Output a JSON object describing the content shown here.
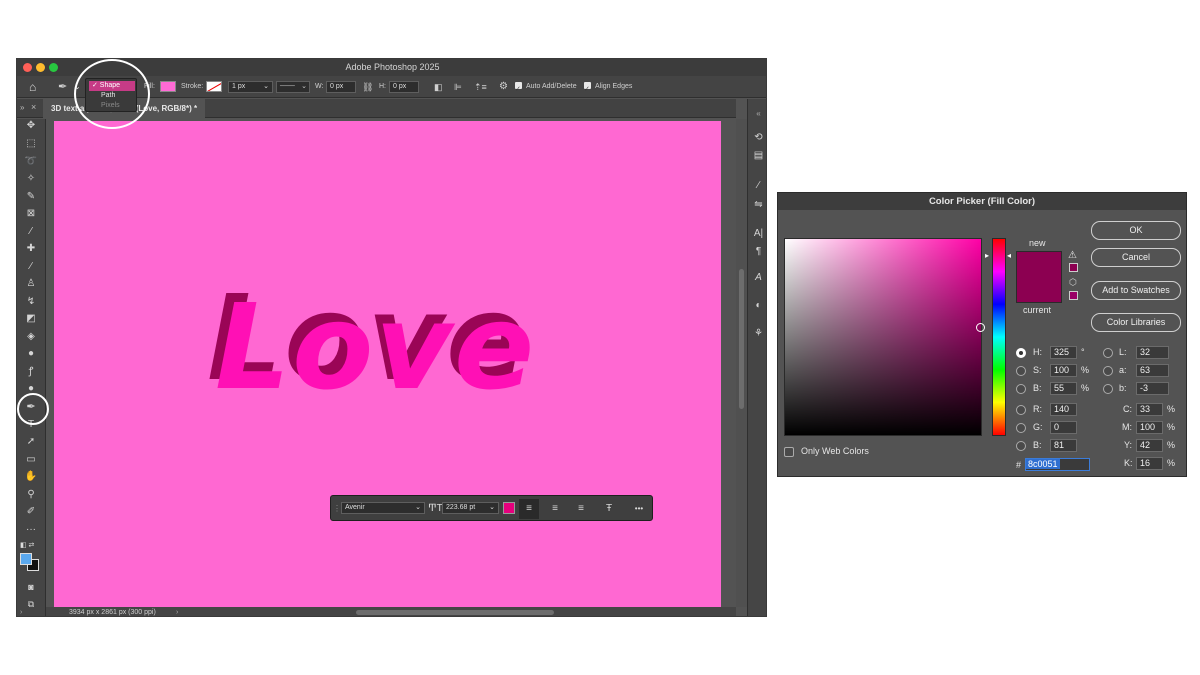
{
  "photoshop": {
    "title": "Adobe Photoshop 2025",
    "options": {
      "stroke_label": "Stroke:",
      "stroke_width": "1 px",
      "w_label": "W:",
      "w_value": "0 px",
      "h_label": "H:",
      "h_value": "0 px",
      "auto_add_delete": "Auto Add/Delete",
      "align_edges": "Align Edges",
      "fill_color": "#ff6ad5"
    },
    "mode_menu": {
      "shape": "✓ Shape",
      "path": "Path",
      "pixels": "Pixels"
    },
    "document_tab": "3D text a    psdc @ 50% (Love, RGB/8*) *",
    "canvas_text": "Love",
    "text_toolbar": {
      "font": "Avenir",
      "size": "223.68 pt",
      "color": "#e5007d",
      "more": "•••"
    },
    "status": "3934 px x 2861 px (300 ppi)",
    "canvas_color": "#ff68d2"
  },
  "color_picker": {
    "title": "Color Picker (Fill Color)",
    "new_label": "new",
    "current_label": "current",
    "new_color": "#8c0051",
    "current_color": "#8c0051",
    "buttons": {
      "ok": "OK",
      "cancel": "Cancel",
      "add_to_swatches": "Add to Swatches",
      "color_libraries": "Color Libraries"
    },
    "only_web_colors": "Only Web Colors",
    "hsb": {
      "h_label": "H:",
      "h": "325",
      "h_unit": "°",
      "s_label": "S:",
      "s": "100",
      "s_unit": "%",
      "b_label": "B:",
      "b": "55",
      "b_unit": "%"
    },
    "rgb": {
      "r_label": "R:",
      "r": "140",
      "g_label": "G:",
      "g": "0",
      "b_label": "B:",
      "b": "81"
    },
    "lab": {
      "l_label": "L:",
      "l": "32",
      "a_label": "a:",
      "a": "63",
      "b_label": "b:",
      "b": "-3"
    },
    "cmyk": {
      "c_label": "C:",
      "c": "33",
      "m_label": "M:",
      "m": "100",
      "y_label": "Y:",
      "y": "42",
      "k_label": "K:",
      "k": "16",
      "unit": "%"
    },
    "hex_label": "#",
    "hex": "8c0051"
  }
}
